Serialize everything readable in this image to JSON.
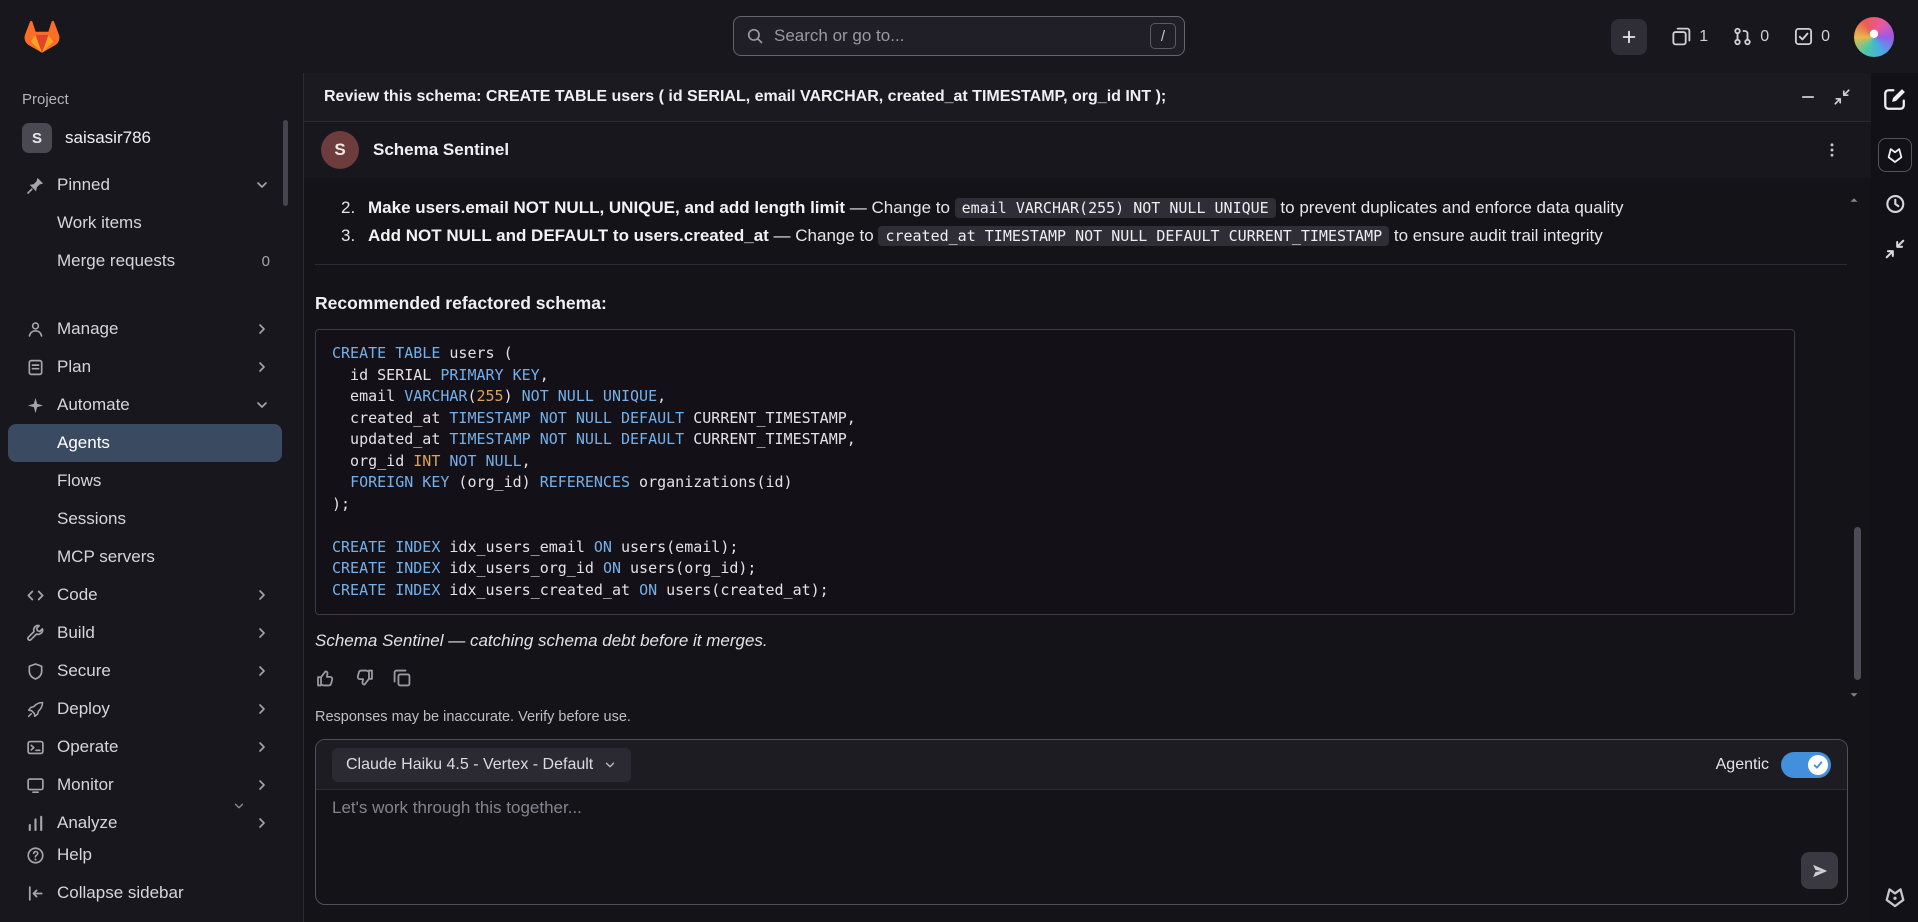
{
  "topbar": {
    "search_placeholder": "Search or go to...",
    "search_shortcut": "/",
    "issues_count": "1",
    "merge_requests_count": "0",
    "todos_count": "0"
  },
  "sidebar": {
    "section_label": "Project",
    "project_initial": "S",
    "project_name": "saisasir786",
    "pinned_label": "Pinned",
    "pinned_items": [
      {
        "label": "Work items"
      },
      {
        "label": "Merge requests",
        "badge": "0"
      }
    ],
    "items": [
      {
        "icon": "manage-icon",
        "sym": "i-manage",
        "label": "Manage"
      },
      {
        "icon": "plan-icon",
        "sym": "i-plan",
        "label": "Plan"
      },
      {
        "icon": "automate-icon",
        "sym": "i-automate",
        "label": "Automate",
        "expanded": true,
        "children": [
          {
            "label": "Agents",
            "selected": true
          },
          {
            "label": "Flows"
          },
          {
            "label": "Sessions"
          },
          {
            "label": "MCP servers"
          }
        ]
      },
      {
        "icon": "code-icon",
        "sym": "i-code",
        "label": "Code"
      },
      {
        "icon": "build-icon",
        "sym": "i-build",
        "label": "Build"
      },
      {
        "icon": "secure-icon",
        "sym": "i-secure",
        "label": "Secure"
      },
      {
        "icon": "deploy-icon",
        "sym": "i-deploy",
        "label": "Deploy"
      },
      {
        "icon": "operate-icon",
        "sym": "i-operate",
        "label": "Operate"
      },
      {
        "icon": "monitor-icon",
        "sym": "i-monitor",
        "label": "Monitor"
      },
      {
        "icon": "analyze-icon",
        "sym": "i-analyze",
        "label": "Analyze"
      }
    ],
    "footer_items": [
      {
        "icon": "help-icon",
        "sym": "i-help",
        "label": "Help"
      },
      {
        "icon": "collapse-sidebar-icon",
        "sym": "i-collapse",
        "label": "Collapse sidebar"
      }
    ]
  },
  "chat": {
    "header_title": "Review this schema: CREATE TABLE users ( id SERIAL, email VARCHAR, created_at TIMESTAMP, org_id INT );",
    "agent_initial": "S",
    "agent_name": "Schema Sentinel",
    "list_items": [
      {
        "num": "2.",
        "bold": "Make users.email NOT NULL, UNIQUE, and add length limit",
        "mid": " — Change to ",
        "code": "email VARCHAR(255) NOT NULL UNIQUE",
        "tail": " to prevent duplicates and enforce data quality"
      },
      {
        "num": "3.",
        "bold": "Add NOT NULL and DEFAULT to users.created_at",
        "mid": " — Change to ",
        "code": "created_at TIMESTAMP NOT NULL DEFAULT CURRENT_TIMESTAMP",
        "tail": " to ensure audit trail integrity"
      }
    ],
    "schema_heading": "Recommended refactored schema:",
    "code_lines": [
      [
        [
          "k",
          "CREATE TABLE"
        ],
        [
          "p",
          " users ("
        ]
      ],
      [
        [
          "p",
          "  id SERIAL "
        ],
        [
          "k",
          "PRIMARY KEY"
        ],
        [
          "p",
          ","
        ]
      ],
      [
        [
          "p",
          "  email "
        ],
        [
          "k",
          "VARCHAR"
        ],
        [
          "p",
          "("
        ],
        [
          "n",
          "255"
        ],
        [
          "p",
          ") "
        ],
        [
          "k",
          "NOT NULL UNIQUE"
        ],
        [
          "p",
          ","
        ]
      ],
      [
        [
          "p",
          "  created_at "
        ],
        [
          "k",
          "TIMESTAMP"
        ],
        [
          "p",
          " "
        ],
        [
          "k",
          "NOT NULL DEFAULT"
        ],
        [
          "p",
          " CURRENT_TIMESTAMP,"
        ]
      ],
      [
        [
          "p",
          "  updated_at "
        ],
        [
          "k",
          "TIMESTAMP"
        ],
        [
          "p",
          " "
        ],
        [
          "k",
          "NOT NULL DEFAULT"
        ],
        [
          "p",
          " CURRENT_TIMESTAMP,"
        ]
      ],
      [
        [
          "p",
          "  org_id "
        ],
        [
          "n",
          "INT"
        ],
        [
          "p",
          " "
        ],
        [
          "k",
          "NOT NULL"
        ],
        [
          "p",
          ","
        ]
      ],
      [
        [
          "p",
          "  "
        ],
        [
          "k",
          "FOREIGN KEY"
        ],
        [
          "p",
          " (org_id) "
        ],
        [
          "k",
          "REFERENCES"
        ],
        [
          "p",
          " organizations(id)"
        ]
      ],
      [
        [
          "p",
          ");"
        ]
      ],
      [],
      [
        [
          "k",
          "CREATE INDEX"
        ],
        [
          "p",
          " idx_users_email "
        ],
        [
          "k",
          "ON"
        ],
        [
          "p",
          " users(email);"
        ]
      ],
      [
        [
          "k",
          "CREATE INDEX"
        ],
        [
          "p",
          " idx_users_org_id "
        ],
        [
          "k",
          "ON"
        ],
        [
          "p",
          " users(org_id);"
        ]
      ],
      [
        [
          "k",
          "CREATE INDEX"
        ],
        [
          "p",
          " idx_users_created_at "
        ],
        [
          "k",
          "ON"
        ],
        [
          "p",
          " users(created_at);"
        ]
      ]
    ],
    "signature": "Schema Sentinel — catching schema debt before it merges.",
    "disclaimer": "Responses may be inaccurate. Verify before use.",
    "model_selector": "Claude Haiku 4.5 - Vertex - Default",
    "agentic_label": "Agentic",
    "agentic_on": true,
    "input_placeholder": "Let's work through this together..."
  },
  "colors": {
    "accent_blue": "#428fdc",
    "keyword_blue": "#74b0ea",
    "number_orange": "#dca35a",
    "selected_nav": "#3a4b61",
    "logo_orange": "#fc6d26",
    "logo_red": "#e24329",
    "logo_amber": "#fca326"
  }
}
